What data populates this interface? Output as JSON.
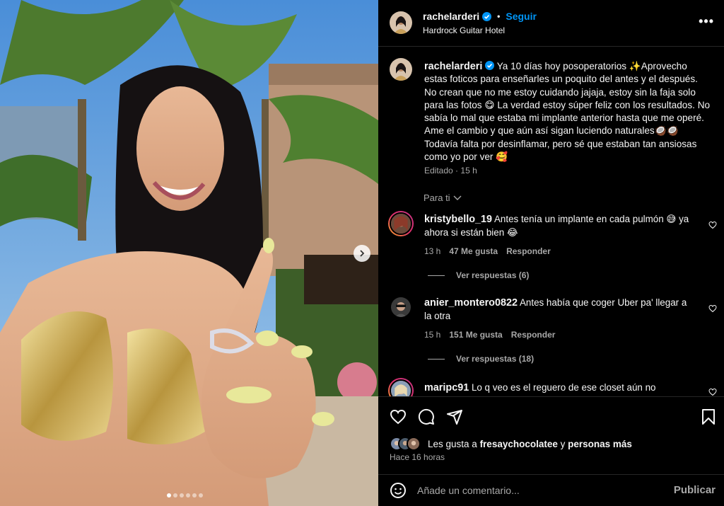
{
  "photo": {
    "image_description_icon": "post-photo",
    "carousel_dot_count": 6,
    "carousel_active_index": 0,
    "next_icon": "chevron-right-icon"
  },
  "header": {
    "username": "rachelarderi",
    "verified_icon": "verified-badge-icon",
    "separator": "•",
    "follow_label": "Seguir",
    "location": "Hardrock Guitar Hotel",
    "more_icon": "more-options-icon",
    "more_label": "•••"
  },
  "caption": {
    "username": "rachelarderi",
    "text": "Ya 10 días hoy posoperatorios ✨Aprovecho estas foticos para enseñarles un poquito del antes y el después. No crean que no me estoy cuidando jajaja, estoy sin la faja solo para las fotos 😋 La verdad estoy súper feliz con los resultados. No sabía lo mal que estaba mi implante anterior hasta que me operé. Ame el cambio y que aún así sigan luciendo naturales🥥🥥 Todavía falta por desinflamar, pero sé que estaban tan ansiosas como yo por ver 🥰",
    "edited": "Editado",
    "dot": "·",
    "time": "15 h"
  },
  "filter": {
    "label": "Para ti",
    "chevron": "﹀"
  },
  "comments": [
    {
      "username": "kristybello_19",
      "text": "Antes tenía un implante en cada pulmón 😅 ya ahora si están bien 😂",
      "time": "13 h",
      "likes": "47 Me gusta",
      "reply": "Responder",
      "view_replies": "Ver respuestas (6)"
    },
    {
      "username": "anier_montero0822",
      "text": "Antes había que coger Uber pa' llegar a la otra",
      "time": "15 h",
      "likes": "151 Me gusta",
      "reply": "Responder",
      "view_replies": "Ver respuestas (18)"
    },
    {
      "username": "maripc91",
      "text": "Lo q veo es el reguero de ese closet aún no",
      "time": "",
      "likes": "",
      "reply": ""
    }
  ],
  "actions": {
    "like_icon": "heart-icon",
    "comment_icon": "comment-icon",
    "share_icon": "share-icon",
    "save_icon": "bookmark-icon"
  },
  "likes": {
    "prefix": "Les gusta a ",
    "user": "fresaychocolatee",
    "middle": " y ",
    "others": "personas más"
  },
  "post_time": "Hace 16 horas",
  "add_comment": {
    "emoji_icon": "emoji-icon",
    "placeholder": "Añade un comentario...",
    "publish_label": "Publicar"
  }
}
